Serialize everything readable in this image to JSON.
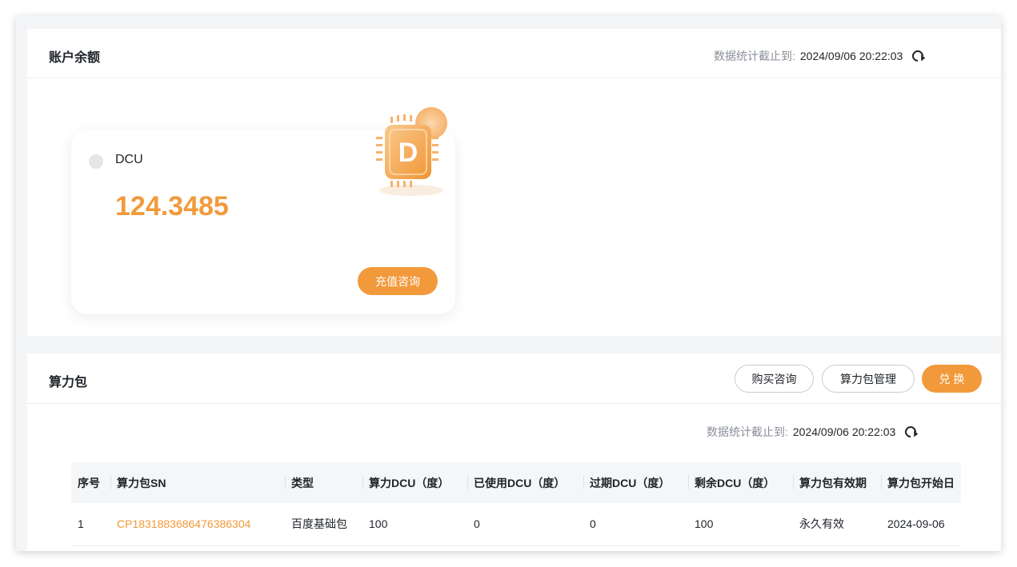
{
  "balance": {
    "title": "账户余额",
    "stat_label": "数据统计截止到:",
    "stat_time": "2024/09/06 20:22:03",
    "card": {
      "label": "DCU",
      "value": "124.3485",
      "chip_letter": "D",
      "recharge_label": "充值咨询"
    }
  },
  "packages": {
    "title": "算力包",
    "buttons": {
      "buy": "购买咨询",
      "manage": "算力包管理",
      "exchange": "兑 换"
    },
    "stat_label": "数据统计截止到:",
    "stat_time": "2024/09/06 20:22:03",
    "columns": [
      "序号",
      "算力包SN",
      "类型",
      "算力DCU（度）",
      "已使用DCU（度）",
      "过期DCU（度）",
      "剩余DCU（度）",
      "算力包有效期",
      "算力包开始日"
    ],
    "rows": [
      [
        "1",
        "CP1831883686476386304",
        "百度基础包",
        "100",
        "0",
        "0",
        "100",
        "永久有效",
        "2024-09-06"
      ]
    ]
  },
  "colors": {
    "accent": "#f29a3b",
    "muted": "#8a8f99"
  }
}
